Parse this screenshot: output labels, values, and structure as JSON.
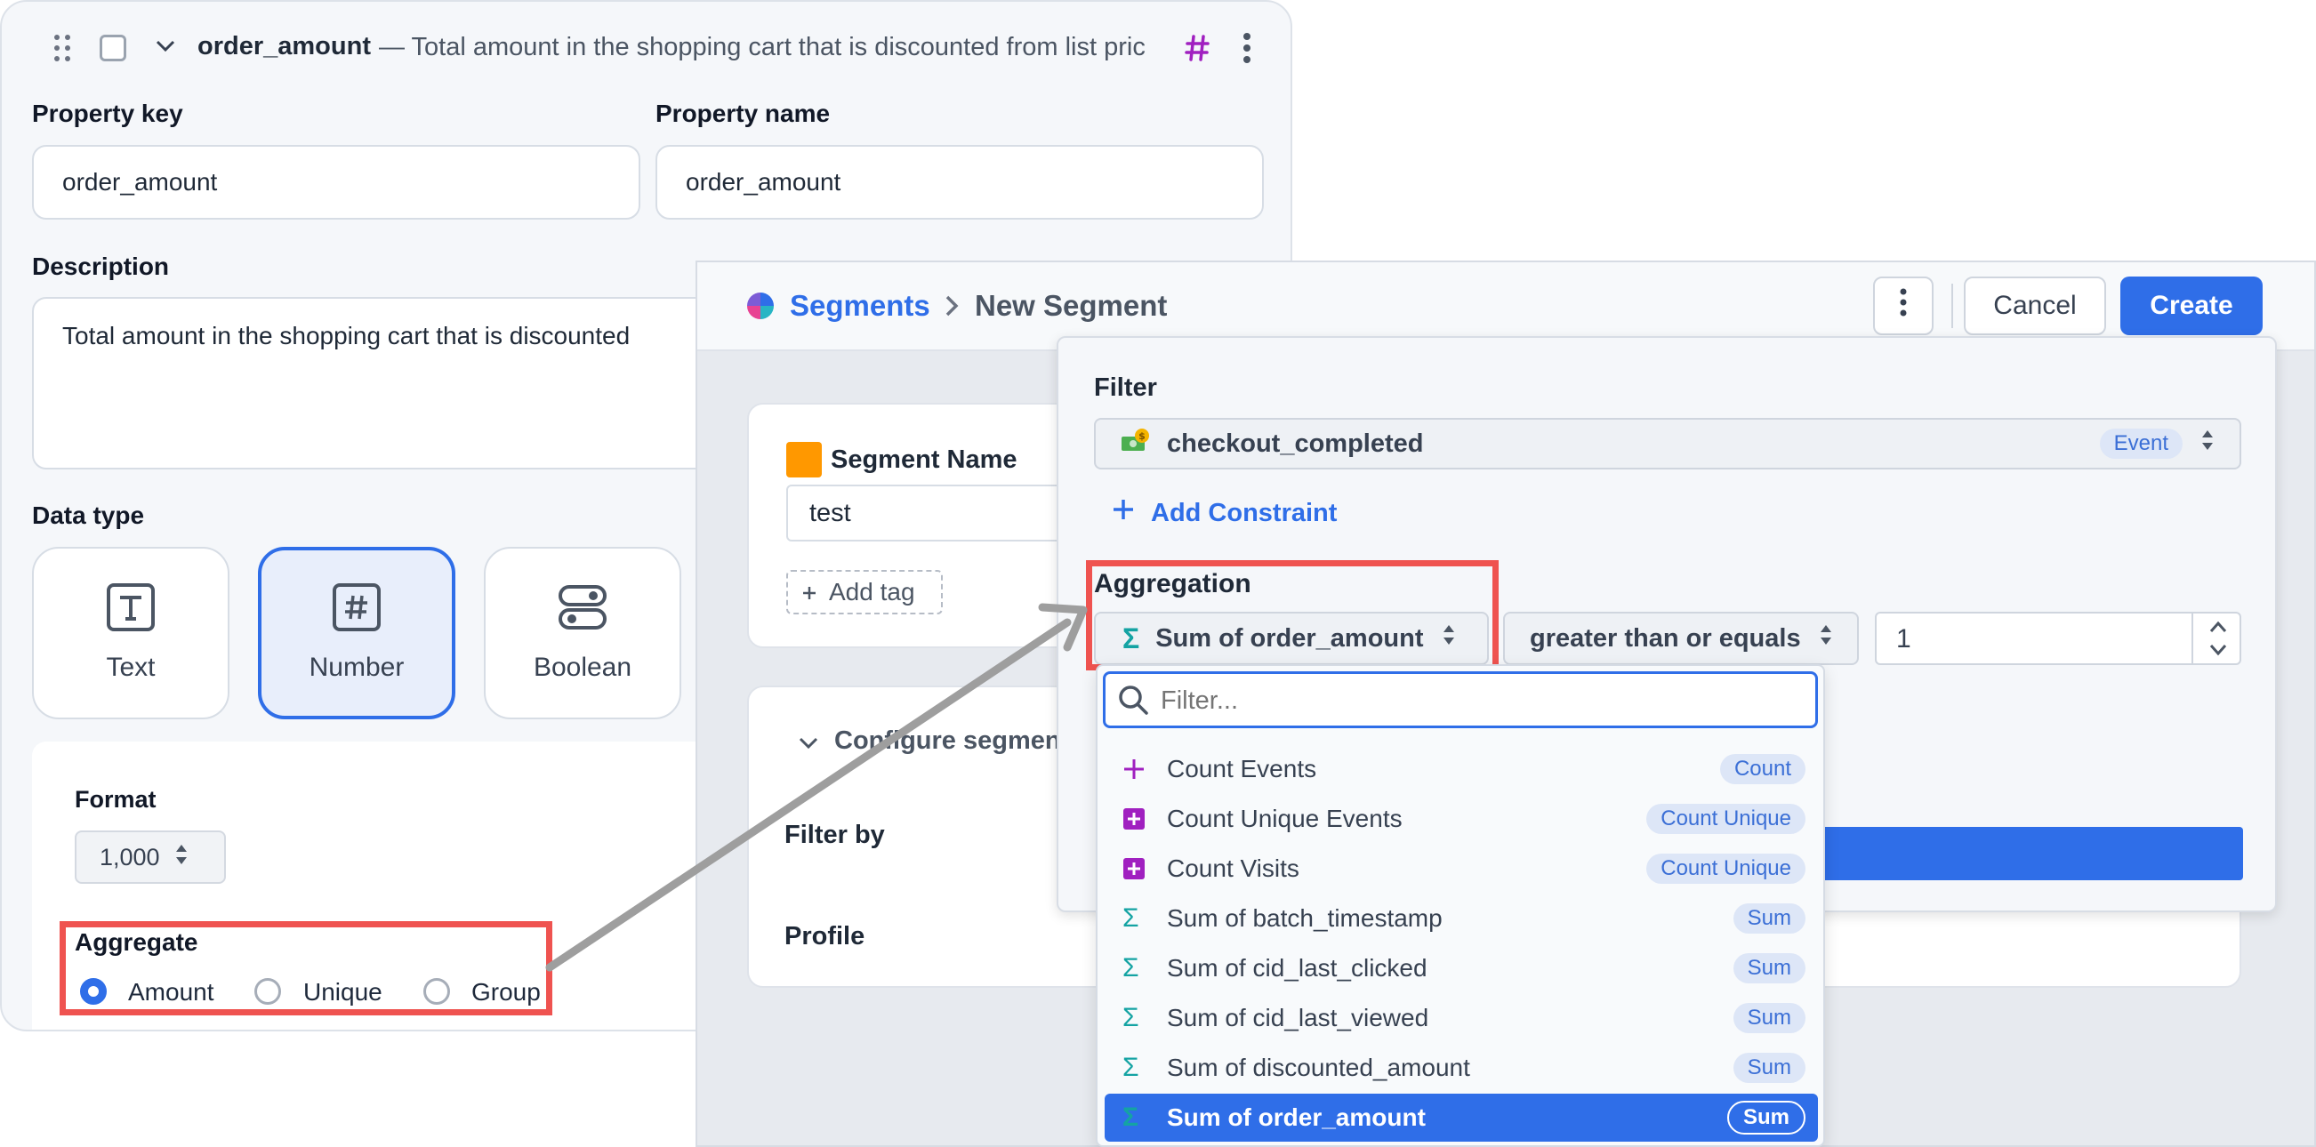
{
  "property_panel": {
    "property_title": "order_amount",
    "property_summary": "— Total amount in the shopping cart that is discounted from list pric",
    "property_key_label": "Property key",
    "property_key_value": "order_amount",
    "property_name_label": "Property name",
    "property_name_value": "order_amount",
    "description_label": "Description",
    "description_value": "Total amount in the shopping cart that is discounted",
    "data_type_label": "Data type",
    "data_types": [
      "Text",
      "Number",
      "Boolean"
    ],
    "selected_data_type": "Number",
    "format_label": "Format",
    "format_value": "1,000",
    "aggregate_label": "Aggregate",
    "aggregate_options": [
      "Amount",
      "Unique",
      "Group"
    ],
    "aggregate_selected": "Amount"
  },
  "segments": {
    "breadcrumb_root": "Segments",
    "breadcrumb_current": "New Segment",
    "cancel_label": "Cancel",
    "create_label": "Create",
    "segment_name_label": "Segment Name",
    "segment_name_value": "test",
    "add_tag_label": "Add tag",
    "configure_label": "Configure segmen",
    "filter_by_label": "Filter by",
    "profile_label": "Profile"
  },
  "filter": {
    "title": "Filter",
    "event_name": "checkout_completed",
    "event_badge": "Event",
    "add_constraint_label": "Add Constraint",
    "aggregation_label": "Aggregation",
    "aggregation_value": "Sum of order_amount",
    "operator_value": "greater than or equals",
    "number_value": "1"
  },
  "dropdown": {
    "search_placeholder": "Filter...",
    "options": [
      {
        "label": "Count Events",
        "badge": "Count",
        "icon": "plus-icon"
      },
      {
        "label": "Count Unique Events",
        "badge": "Count Unique",
        "icon": "plus-square-icon"
      },
      {
        "label": "Count Visits",
        "badge": "Count Unique",
        "icon": "plus-square-icon"
      },
      {
        "label": "Sum of batch_timestamp",
        "badge": "Sum",
        "icon": "sigma-icon"
      },
      {
        "label": "Sum of cid_last_clicked",
        "badge": "Sum",
        "icon": "sigma-icon"
      },
      {
        "label": "Sum of cid_last_viewed",
        "badge": "Sum",
        "icon": "sigma-icon"
      },
      {
        "label": "Sum of discounted_amount",
        "badge": "Sum",
        "icon": "sigma-icon"
      },
      {
        "label": "Sum of order_amount",
        "badge": "Sum",
        "icon": "sigma-icon",
        "selected": true
      }
    ]
  },
  "colors": {
    "accent": "#2f6ee8",
    "highlight_red": "#ef5350",
    "hash_purple": "#a020c0",
    "sigma_teal": "#14a3a3",
    "segment_orange": "#ff9800"
  }
}
